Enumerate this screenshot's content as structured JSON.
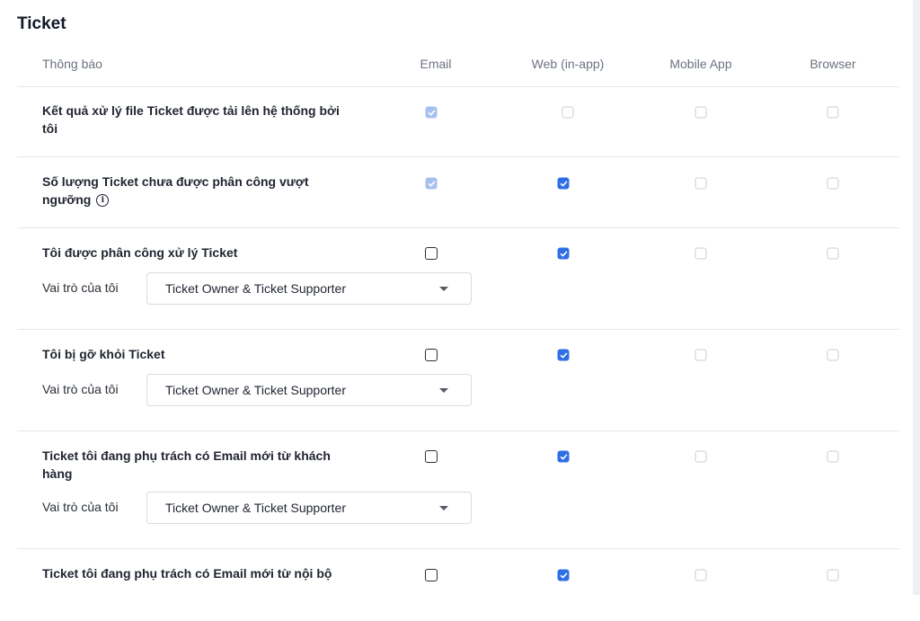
{
  "section": {
    "title": "Ticket"
  },
  "columns": {
    "notification": "Thông báo",
    "email": "Email",
    "web": "Web (in-app)",
    "mobile": "Mobile App",
    "browser": "Browser"
  },
  "role_label": "Vai trò của tôi",
  "rows": [
    {
      "label": "Kết quả xử lý file Ticket được tải lên hệ thống bởi tôi",
      "email": "checked-disabled",
      "web": "unchecked-disabled",
      "mobile": "unchecked-disabled",
      "browser": "unchecked-disabled"
    },
    {
      "label": "Số lượng Ticket chưa được phân công vượt ngưỡng",
      "info_icon": "info-circle-icon",
      "email": "checked-disabled",
      "web": "checked",
      "mobile": "unchecked-disabled",
      "browser": "unchecked-disabled"
    },
    {
      "label": "Tôi được phân công xử lý Ticket",
      "role_value": "Ticket Owner & Ticket Supporter",
      "email": "unchecked",
      "web": "checked",
      "mobile": "unchecked-disabled",
      "browser": "unchecked-disabled"
    },
    {
      "label": "Tôi bị gỡ khỏi Ticket",
      "role_value": "Ticket Owner & Ticket Supporter",
      "email": "unchecked",
      "web": "checked",
      "mobile": "unchecked-disabled",
      "browser": "unchecked-disabled"
    },
    {
      "label": "Ticket tôi đang phụ trách có Email mới từ khách hàng",
      "role_value": "Ticket Owner & Ticket Supporter",
      "email": "unchecked",
      "web": "checked",
      "mobile": "unchecked-disabled",
      "browser": "unchecked-disabled"
    },
    {
      "label": "Ticket tôi đang phụ trách có Email mới từ nội bộ",
      "email": "unchecked",
      "web": "checked",
      "mobile": "unchecked-disabled",
      "browser": "unchecked-disabled"
    }
  ],
  "colors": {
    "accent": "#2f6ee6",
    "accent_disabled": "#a7c0ef",
    "border": "#e5e7eb"
  }
}
